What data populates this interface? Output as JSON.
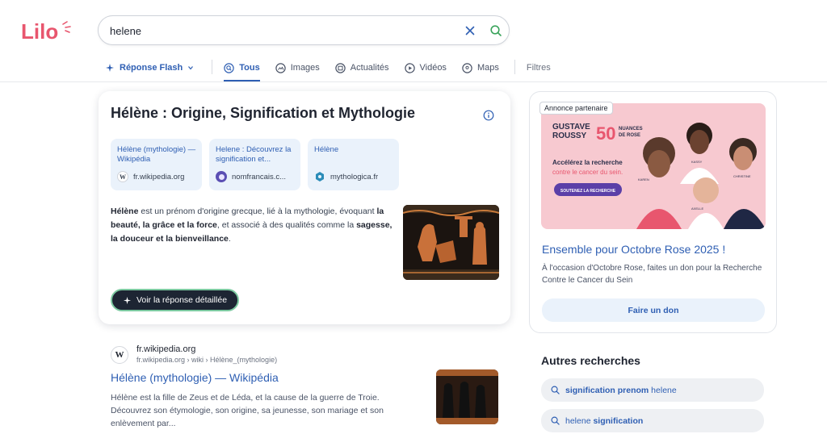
{
  "brand": {
    "logo_text": "Lilo",
    "color": "#e8566e"
  },
  "search": {
    "value": "helene",
    "placeholder": ""
  },
  "tabs": {
    "flash": "Réponse Flash",
    "all": "Tous",
    "images": "Images",
    "news": "Actualités",
    "videos": "Vidéos",
    "maps": "Maps",
    "filters": "Filtres"
  },
  "answer": {
    "title": "Hélène : Origine, Signification et Mythologie",
    "sources": [
      {
        "title": "Hélène (mythologie) — Wikipédia",
        "domain": "fr.wikipedia.org",
        "icon": "wikipedia-icon"
      },
      {
        "title": "Helene : Découvrez la signification et...",
        "domain": "nomfrancais.c...",
        "icon": "nomfrancais-icon"
      },
      {
        "title": "Hélène",
        "domain": "mythologica.fr",
        "icon": "mythologica-icon"
      }
    ],
    "text_parts": {
      "p1": "Hélène",
      "p2": " est un prénom d'origine grecque, lié à la mythologie, évoquant ",
      "p3": "la beauté, la grâce et la force",
      "p4": ", et associé à des qualités comme la ",
      "p5": "sagesse, la douceur et la bienveillance",
      "p6": "."
    },
    "detail_button": "Voir la réponse détaillée"
  },
  "result": {
    "domain": "fr.wikipedia.org",
    "url": "fr.wikipedia.org › wiki › Hélène_(mythologie)",
    "title": "Hélène (mythologie) — Wikipédia",
    "snippet": "Hélène est la fille de Zeus et de Léda, et la cause de la guerre de Troie. Découvrez son étymologie, son origine, sa jeunesse, son mariage et son enlèvement par..."
  },
  "ad": {
    "badge": "Annonce partenaire",
    "banner": {
      "brand_line1": "GUSTAVE",
      "brand_line2": "ROUSSY",
      "fifty": "50",
      "nuances_line1": "NUANCES",
      "nuances_line2": "DE ROSE",
      "headline_line1": "Accélérez la recherche",
      "headline_line2": "contre le cancer du sein.",
      "cta": "SOUTENEZ LA RECHERCHE",
      "people": [
        "KAREN",
        "KASSY",
        "CHRISTINE",
        "AXELLE"
      ]
    },
    "title": "Ensemble pour Octobre Rose 2025 !",
    "description": "À l'occasion d'Octobre Rose, faites un don pour la Recherche Contre le Cancer du Sein",
    "button": "Faire un don"
  },
  "other_searches": {
    "title": "Autres recherches",
    "items": [
      {
        "bold": "signification prenom",
        "normal": " helene",
        "prefix": ""
      },
      {
        "prefix": "helene ",
        "bold": "signification",
        "normal": ""
      }
    ]
  },
  "colors": {
    "accent": "#2f5fb3",
    "dark_button": "#1d2533",
    "chip_bg": "#eef0f3",
    "source_bg": "#eaf2fb"
  }
}
